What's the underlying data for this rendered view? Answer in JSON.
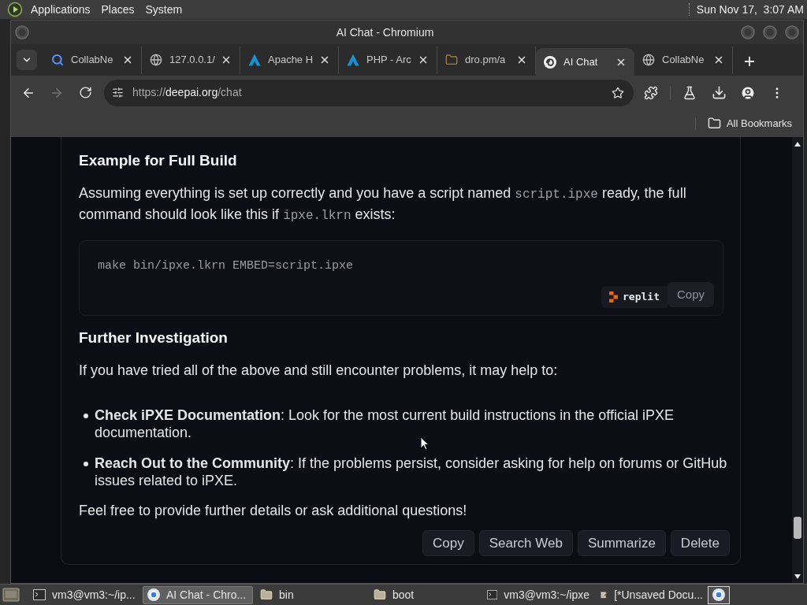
{
  "top_panel": {
    "menus": [
      "Applications",
      "Places",
      "System"
    ],
    "clock": "Sun Nov 17,  3:07 AM"
  },
  "window": {
    "title": "AI Chat - Chromium"
  },
  "tabs": [
    {
      "title": "CollabNe",
      "kind": "search",
      "selected": false
    },
    {
      "title": "127.0.0.1/",
      "kind": "globe",
      "selected": false
    },
    {
      "title": "Apache H",
      "kind": "peak",
      "selected": false
    },
    {
      "title": "PHP - Arc",
      "kind": "peak",
      "selected": false
    },
    {
      "title": "dro.pm/a",
      "kind": "folder",
      "selected": false
    },
    {
      "title": "AI Chat",
      "kind": "swirl",
      "selected": true
    },
    {
      "title": "CollabNe",
      "kind": "globe",
      "selected": false
    }
  ],
  "toolbar": {
    "nav": [
      {
        "kind": "back",
        "disabled": false
      },
      {
        "kind": "forward",
        "disabled": true
      },
      {
        "kind": "reload",
        "disabled": false
      }
    ],
    "url": {
      "scheme": "https://",
      "host": "deepai.org",
      "path": "/chat"
    }
  },
  "bookmarks_bar": {
    "folders": [
      "All Bookmarks"
    ]
  },
  "message": {
    "blocks": [
      {
        "kind": "heading",
        "text": "Example for Full Build"
      },
      {
        "kind": "paragraph",
        "segments": [
          {
            "kind": "text",
            "text": "Assuming everything is set up correctly and you have a script named "
          },
          {
            "kind": "code",
            "text": "script.ipxe"
          },
          {
            "kind": "text",
            "text": " ready, the full command should look like this if "
          },
          {
            "kind": "code",
            "text": "ipxe.lkrn"
          },
          {
            "kind": "text",
            "text": " exists:"
          }
        ]
      },
      {
        "kind": "code_block",
        "code": "make bin/ipxe.lkrn EMBED=script.ipxe",
        "badge": "replit",
        "copy": "Copy"
      },
      {
        "kind": "heading",
        "text": "Further Investigation"
      },
      {
        "kind": "paragraph",
        "segments": [
          {
            "kind": "text",
            "text": "If you have tried all of the above and still encounter problems, it may help to:"
          }
        ]
      },
      {
        "kind": "list",
        "items": [
          "**Check iPXE Documentation**: Look for the most current build instructions in the official iPXE documentation.",
          "**Reach Out to the Community**: If the problems persist, consider asking for help on forums or GitHub issues related to iPXE."
        ]
      },
      {
        "kind": "paragraph",
        "segments": [
          {
            "kind": "text",
            "text": "Feel free to provide further details or ask additional questions!"
          }
        ]
      }
    ],
    "actions": [
      "Copy",
      "Search Web",
      "Summarize",
      "Delete"
    ]
  },
  "taskbar": {
    "items": [
      {
        "label": "vm3@vm3:~/ip...",
        "kind": "terminal",
        "selected": false
      },
      {
        "label": "AI Chat - Chro...",
        "kind": "browser",
        "selected": true
      },
      {
        "label": "bin",
        "kind": "folder",
        "selected": false
      },
      {
        "label": "boot",
        "kind": "folder",
        "selected": false
      },
      {
        "label": "vm3@vm3:~/ipxe",
        "kind": "terminal",
        "selected": false
      },
      {
        "label": "[*Unsaved Docu...",
        "kind": "editor",
        "selected": false
      }
    ]
  }
}
